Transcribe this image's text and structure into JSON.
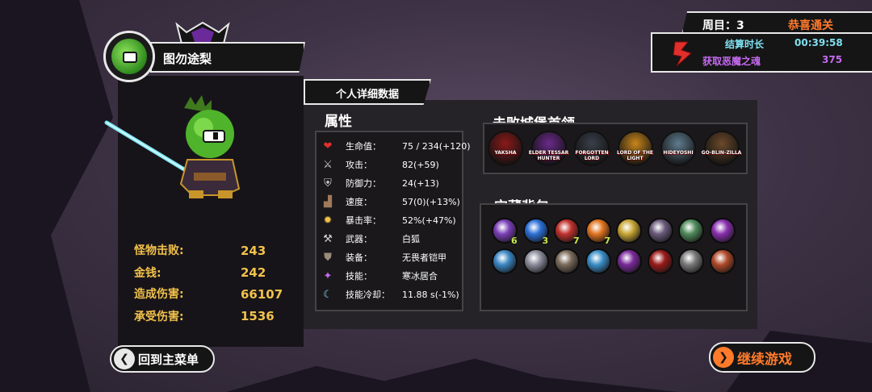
{
  "character": {
    "name": "图勿途梨",
    "icon": "green-slime-avatar"
  },
  "stats": [
    {
      "label": "怪物击败:",
      "value": "243"
    },
    {
      "label": "金钱:",
      "value": "242"
    },
    {
      "label": "造成伤害:",
      "value": "66107"
    },
    {
      "label": "承受伤害:",
      "value": "1536"
    }
  ],
  "detail_tab": "个人详细数据",
  "attributes_title": "属性",
  "attributes": [
    {
      "icon": "heart-icon",
      "label": "生命值：",
      "value": "75 / 234(+120)"
    },
    {
      "icon": "sword-icon",
      "label": "攻击：",
      "value": "82(+59)"
    },
    {
      "icon": "shield-icon",
      "label": "防御力：",
      "value": "24(+13)"
    },
    {
      "icon": "boot-icon",
      "label": "速度：",
      "value": "57(0)(+13%)"
    },
    {
      "icon": "burst-icon",
      "label": "暴击率：",
      "value": "52%(+47%)"
    },
    {
      "icon": "weapon-icon",
      "label": "武器：",
      "value": "白狐"
    },
    {
      "icon": "armor-icon",
      "label": "装备：",
      "value": "无畏者铠甲"
    },
    {
      "icon": "skill-icon",
      "label": "技能：",
      "value": "寒冰居合"
    },
    {
      "icon": "cooldown-icon",
      "label": "技能冷却：",
      "value": "11.88 s(-1%)"
    }
  ],
  "bosses_title": "击败城堡首领",
  "bosses": [
    {
      "name": "YAKSHA",
      "color": "#8b1a1a"
    },
    {
      "name": "ELDER TESSAR HUNTER",
      "color": "#6a2a8a"
    },
    {
      "name": "FORGOTTEN LORD",
      "color": "#3a3f4a"
    },
    {
      "name": "LORD OF THE LIGHT",
      "color": "#c9861b"
    },
    {
      "name": "HIDEYOSHI",
      "color": "#5f7c8f"
    },
    {
      "name": "GO-BLIN-ZILLA",
      "color": "#6b4a2a"
    }
  ],
  "treasure_title": "宝藏背包",
  "treasures": [
    {
      "icon": "purple-crystal-icon",
      "color": "#7b3fb8",
      "count": "6"
    },
    {
      "icon": "blue-orb-icon",
      "color": "#2c6fd6",
      "count": "3"
    },
    {
      "icon": "red-mask-icon",
      "color": "#c0302c",
      "count": "7"
    },
    {
      "icon": "flame-gem-icon",
      "color": "#e0731f",
      "count": "7"
    },
    {
      "icon": "gold-emblem-icon",
      "color": "#c8a634",
      "count": ""
    },
    {
      "icon": "dark-horn-icon",
      "color": "#6a5a7a",
      "count": ""
    },
    {
      "icon": "green-skull-icon",
      "color": "#4f8a5a",
      "count": ""
    },
    {
      "icon": "violet-claw-icon",
      "color": "#8a2fb0",
      "count": ""
    },
    {
      "icon": "ice-shard-icon",
      "color": "#3b86c4",
      "count": ""
    },
    {
      "icon": "silver-dragon-icon",
      "color": "#8c8c9c",
      "count": ""
    },
    {
      "icon": "beast-helm-icon",
      "color": "#7a6a5a",
      "count": ""
    },
    {
      "icon": "cyan-fang-icon",
      "color": "#3a8ec8",
      "count": ""
    },
    {
      "icon": "purple-bat-icon",
      "color": "#7a2a9a",
      "count": ""
    },
    {
      "icon": "red-feather-icon",
      "color": "#9a1a1a",
      "count": ""
    },
    {
      "icon": "stone-skull-icon",
      "color": "#7a7a7a",
      "count": ""
    },
    {
      "icon": "monster-face-icon",
      "color": "#b04a2a",
      "count": ""
    }
  ],
  "summary": {
    "round_label": "周目：3",
    "cleared_label": "恭喜通关",
    "time_label": "结算时长",
    "time_value": "00:39:58",
    "souls_label": "获取恶魔之魂",
    "souls_value": "375"
  },
  "buttons": {
    "main_menu": "回到主菜单",
    "continue": "继续游戏"
  },
  "colors": {
    "gold": "#f2c24b",
    "orange": "#ff7a2a",
    "cyan": "#7fe0f0",
    "purple": "#c56af0",
    "green_count": "#c7e84a"
  }
}
